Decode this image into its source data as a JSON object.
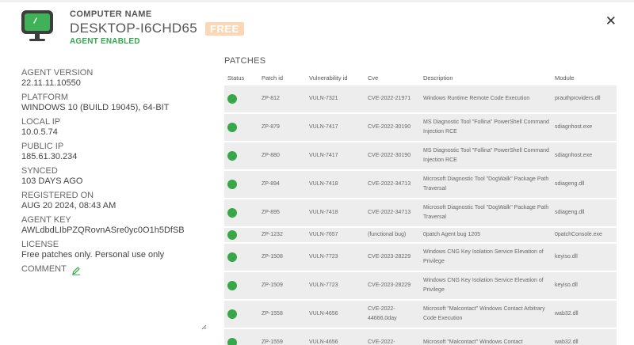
{
  "header": {
    "computer_name_label": "COMPUTER NAME",
    "computer_name": "DESKTOP-I6CHD65",
    "license_badge": "FREE",
    "agent_status": "AGENT ENABLED"
  },
  "details": {
    "agent_version": {
      "label": "AGENT VERSION",
      "value": "22.11.11.10550"
    },
    "platform": {
      "label": "PLATFORM",
      "value": "WINDOWS 10 (BUILD 19045), 64-BIT"
    },
    "local_ip": {
      "label": "LOCAL IP",
      "value": "10.0.5.74"
    },
    "public_ip": {
      "label": "PUBLIC IP",
      "value": "185.61.30.234"
    },
    "synced": {
      "label": "SYNCED",
      "value": "103 DAYS AGO"
    },
    "registered_on": {
      "label": "REGISTERED ON",
      "value": "AUG 20 2024, 08:43 AM"
    },
    "agent_key": {
      "label": "AGENT KEY",
      "value": "AWLdbdLIbPZQRovnASre0yc0O1h5DfSB"
    },
    "license": {
      "label": "LICENSE",
      "value": "Free patches only. Personal use only"
    },
    "comment_label": "COMMENT"
  },
  "patches": {
    "title": "PATCHES",
    "columns": [
      "Status",
      "Patch id",
      "Vulnerability id",
      "Cve",
      "Description",
      "Module"
    ],
    "rows": [
      {
        "patch": "ZP-812",
        "vuln": "VULN-7321",
        "cve": "CVE-2022-21971",
        "desc": "Windows Runtime Remote Code Execution",
        "module": "prauthproviders.dll"
      },
      {
        "patch": "ZP-879",
        "vuln": "VULN-7417",
        "cve": "CVE-2022-30190",
        "desc": "MS Diagnostic Tool \"Follina\" PowerShell Command Injection RCE",
        "module": "sdiagnhost.exe"
      },
      {
        "patch": "ZP-880",
        "vuln": "VULN-7417",
        "cve": "CVE-2022-30190",
        "desc": "MS Diagnostic Tool \"Follina\" PowerShell Command Injection RCE",
        "module": "sdiagnhost.exe"
      },
      {
        "patch": "ZP-894",
        "vuln": "VULN-7418",
        "cve": "CVE-2022-34713",
        "desc": "Microsoft Diagnostic Tool \"DogWalk\" Package Path Traversal",
        "module": "sdiageng.dll"
      },
      {
        "patch": "ZP-895",
        "vuln": "VULN-7418",
        "cve": "CVE-2022-34713",
        "desc": "Microsoft Diagnostic Tool \"DogWalk\" Package Path Traversal",
        "module": "sdiageng.dll"
      },
      {
        "patch": "ZP-1232",
        "vuln": "VULN-7657",
        "cve": "(functional bug)",
        "desc": "0patch Agent bug 1205",
        "module": "0patchConsole.exe"
      },
      {
        "patch": "ZP-1508",
        "vuln": "VULN-7723",
        "cve": "CVE-2023-28229",
        "desc": "Windows CNG Key Isolation Service Elevation of Privilege",
        "module": "keyiso.dll"
      },
      {
        "patch": "ZP-1509",
        "vuln": "VULN-7723",
        "cve": "CVE-2023-28229",
        "desc": "Windows CNG Key Isolation Service Elevation of Privilege",
        "module": "keyiso.dll"
      },
      {
        "patch": "ZP-1558",
        "vuln": "VULN-4656",
        "cve": "CVE-2022-44666,0day",
        "desc": "Microsoft \"Malcontact\" Windows Contact Arbitrary Code Execution",
        "module": "wab32.dll"
      },
      {
        "patch": "ZP-1559",
        "vuln": "VULN-4656",
        "cve": "CVE-2022-",
        "desc": "Microsoft \"Malcontact\" Windows Contact",
        "module": "wab32.dll"
      }
    ]
  },
  "colors": {
    "accent_green": "#37a84a",
    "badge_bg": "#fbd7b6",
    "row_bg": "#ededed"
  },
  "icons": {
    "computer": "monitor-icon",
    "close": "close-icon",
    "comment_edit": "pencil-icon",
    "status": "status-dot-icon"
  }
}
